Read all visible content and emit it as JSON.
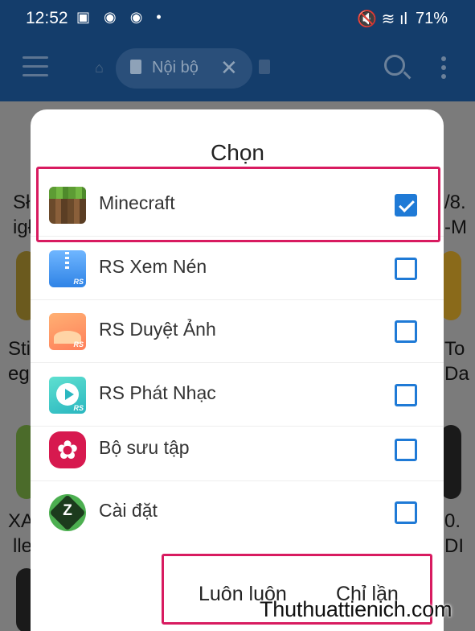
{
  "status_bar": {
    "time": "12:52",
    "notification_icons": "▣ ◉ ◉ •",
    "status_icons": "🔇 ≋ ıl",
    "battery": "71%"
  },
  "app_bar": {
    "tab_label": "Nội bộ",
    "close_glyph": "✕"
  },
  "background_text": {
    "left": [
      "Sł",
      "igł",
      "Sti",
      "eg",
      "XA",
      "lle"
    ],
    "right": [
      "/8.",
      "-M",
      "To",
      "Da",
      "0.",
      "DI"
    ]
  },
  "dialog": {
    "title": "Chọn",
    "apps": [
      {
        "label": "Minecraft",
        "checked": true,
        "icon": "minecraft-icon"
      },
      {
        "label": "RS Xem Nén",
        "checked": false,
        "icon": "zip-viewer-icon"
      },
      {
        "label": "RS Duyệt Ảnh",
        "checked": false,
        "icon": "photo-viewer-icon"
      },
      {
        "label": "RS Phát Nhạc",
        "checked": false,
        "icon": "music-player-icon"
      },
      {
        "label": "Bộ sưu tập",
        "checked": false,
        "icon": "gallery-icon"
      },
      {
        "label": "Cài đặt",
        "checked": false,
        "icon": "zarchiver-icon"
      }
    ],
    "buttons": {
      "always": "Luôn luôn",
      "just_once": "Chỉ lần"
    },
    "icon_badge": "RS"
  },
  "watermark": "Thuthuattienich.com",
  "colors": {
    "accent": "#1f7ad6",
    "highlight": "#d81b60",
    "app_bar": "#143d6b"
  }
}
